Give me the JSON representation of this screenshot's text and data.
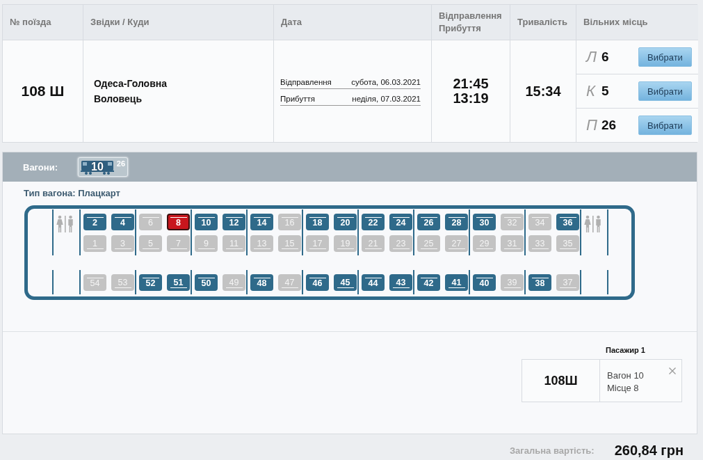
{
  "table": {
    "columns": [
      "№ поїзда",
      "Звідки / Куди",
      "Дата",
      "Відправлення Прибуття",
      "Тривалість",
      "Вільних місць"
    ],
    "train": {
      "number": "108 Ш",
      "from": "Одеса-Головна",
      "to": "Воловець",
      "dates": [
        {
          "label": "Відправлення",
          "value": "субота, 06.03.2021"
        },
        {
          "label": "Прибуття",
          "value": "неділя, 07.03.2021"
        }
      ],
      "departure_time": "21:45",
      "arrival_time": "13:19",
      "duration": "15:34",
      "classes": [
        {
          "letter": "Л",
          "count": "6",
          "button": "Вибрати"
        },
        {
          "letter": "К",
          "count": "5",
          "button": "Вибрати"
        },
        {
          "letter": "П",
          "count": "26",
          "button": "Вибрати"
        }
      ]
    }
  },
  "wagons": {
    "label": "Вагони:",
    "items": [
      {
        "number": "10",
        "free": "26",
        "selected": true
      }
    ]
  },
  "wagon_type": "Тип вагона: Плацкарт",
  "car": {
    "compartments": [
      {
        "upper": [
          {
            "number": "2",
            "free": true,
            "selected": false
          },
          {
            "number": "4",
            "free": true,
            "selected": false
          }
        ],
        "lower": [
          {
            "number": "1",
            "free": false,
            "selected": false
          },
          {
            "number": "3",
            "free": false,
            "selected": false
          }
        ],
        "side": [
          {
            "number": "54",
            "free": false,
            "selected": false,
            "upper": true
          },
          {
            "number": "53",
            "free": false,
            "selected": false,
            "upper": false
          }
        ]
      },
      {
        "upper": [
          {
            "number": "6",
            "free": false,
            "selected": false
          },
          {
            "number": "8",
            "free": true,
            "selected": true
          }
        ],
        "lower": [
          {
            "number": "5",
            "free": false,
            "selected": false
          },
          {
            "number": "7",
            "free": false,
            "selected": false
          }
        ],
        "side": [
          {
            "number": "52",
            "free": true,
            "selected": false,
            "upper": true
          },
          {
            "number": "51",
            "free": true,
            "selected": false,
            "upper": false
          }
        ]
      },
      {
        "upper": [
          {
            "number": "10",
            "free": true,
            "selected": false
          },
          {
            "number": "12",
            "free": true,
            "selected": false
          }
        ],
        "lower": [
          {
            "number": "9",
            "free": false,
            "selected": false
          },
          {
            "number": "11",
            "free": false,
            "selected": false
          }
        ],
        "side": [
          {
            "number": "50",
            "free": true,
            "selected": false,
            "upper": true
          },
          {
            "number": "49",
            "free": false,
            "selected": false,
            "upper": false
          }
        ]
      },
      {
        "upper": [
          {
            "number": "14",
            "free": true,
            "selected": false
          },
          {
            "number": "16",
            "free": false,
            "selected": false
          }
        ],
        "lower": [
          {
            "number": "13",
            "free": false,
            "selected": false
          },
          {
            "number": "15",
            "free": false,
            "selected": false
          }
        ],
        "side": [
          {
            "number": "48",
            "free": true,
            "selected": false,
            "upper": true
          },
          {
            "number": "47",
            "free": false,
            "selected": false,
            "upper": false
          }
        ]
      },
      {
        "upper": [
          {
            "number": "18",
            "free": true,
            "selected": false
          },
          {
            "number": "20",
            "free": true,
            "selected": false
          }
        ],
        "lower": [
          {
            "number": "17",
            "free": false,
            "selected": false
          },
          {
            "number": "19",
            "free": false,
            "selected": false
          }
        ],
        "side": [
          {
            "number": "46",
            "free": true,
            "selected": false,
            "upper": true
          },
          {
            "number": "45",
            "free": true,
            "selected": false,
            "upper": false
          }
        ]
      },
      {
        "upper": [
          {
            "number": "22",
            "free": true,
            "selected": false
          },
          {
            "number": "24",
            "free": true,
            "selected": false
          }
        ],
        "lower": [
          {
            "number": "21",
            "free": false,
            "selected": false
          },
          {
            "number": "23",
            "free": false,
            "selected": false
          }
        ],
        "side": [
          {
            "number": "44",
            "free": true,
            "selected": false,
            "upper": true
          },
          {
            "number": "43",
            "free": true,
            "selected": false,
            "upper": false
          }
        ]
      },
      {
        "upper": [
          {
            "number": "26",
            "free": true,
            "selected": false
          },
          {
            "number": "28",
            "free": true,
            "selected": false
          }
        ],
        "lower": [
          {
            "number": "25",
            "free": false,
            "selected": false
          },
          {
            "number": "27",
            "free": false,
            "selected": false
          }
        ],
        "side": [
          {
            "number": "42",
            "free": true,
            "selected": false,
            "upper": true
          },
          {
            "number": "41",
            "free": true,
            "selected": false,
            "upper": false
          }
        ]
      },
      {
        "upper": [
          {
            "number": "30",
            "free": true,
            "selected": false
          },
          {
            "number": "32",
            "free": false,
            "selected": false
          }
        ],
        "lower": [
          {
            "number": "29",
            "free": false,
            "selected": false
          },
          {
            "number": "31",
            "free": false,
            "selected": false
          }
        ],
        "side": [
          {
            "number": "40",
            "free": true,
            "selected": false,
            "upper": true
          },
          {
            "number": "39",
            "free": false,
            "selected": false,
            "upper": false
          }
        ]
      },
      {
        "upper": [
          {
            "number": "34",
            "free": false,
            "selected": false
          },
          {
            "number": "36",
            "free": true,
            "selected": false
          }
        ],
        "lower": [
          {
            "number": "33",
            "free": false,
            "selected": false
          },
          {
            "number": "35",
            "free": false,
            "selected": false
          }
        ],
        "side": [
          {
            "number": "38",
            "free": true,
            "selected": false,
            "upper": true
          },
          {
            "number": "37",
            "free": false,
            "selected": false,
            "upper": false
          }
        ]
      }
    ]
  },
  "passenger": {
    "title": "Пасажир 1",
    "train": "108Ш",
    "wagon": "Вагон 10",
    "seat": "Місце 8"
  },
  "total": {
    "label": "Загальна вартість:",
    "amount": "260,84 грн"
  }
}
